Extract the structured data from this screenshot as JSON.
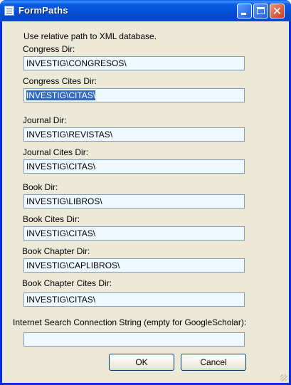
{
  "window": {
    "title": "FormPaths"
  },
  "intro": "Use relative path to XML database.",
  "fields": [
    {
      "label": "Congress Dir:",
      "value": "INVESTIG\\CONGRESOS\\"
    },
    {
      "label": "Congress Cites Dir:",
      "value": "INVESTIG\\CITAS\\"
    },
    {
      "label": "Journal Dir:",
      "value": "INVESTIG\\REVISTAS\\"
    },
    {
      "label": "Journal Cites Dir:",
      "value": "INVESTIG\\CITAS\\"
    },
    {
      "label": "Book Dir:",
      "value": "INVESTIG\\LIBROS\\"
    },
    {
      "label": "Book Cites Dir:",
      "value": "INVESTIG\\CITAS\\"
    },
    {
      "label": "Book Chapter Dir:",
      "value": "INVESTIG\\CAPLIBROS\\"
    },
    {
      "label": "Book Chapter Cites Dir:",
      "value": "INVESTIG\\CITAS\\"
    },
    {
      "label": "Internet Search Connection String (empty for GoogleScholar):",
      "value": ""
    }
  ],
  "buttons": {
    "ok": "OK",
    "cancel": "Cancel"
  },
  "colors": {
    "titlebar": "#0a5ce6",
    "background": "#ece9d8",
    "field_bg": "#f0f8ff",
    "selection": "#316ac5"
  },
  "icons": {
    "app": "form-icon",
    "minimize": "minimize-icon",
    "maximize": "maximize-icon",
    "close": "close-icon",
    "grip": "resize-grip-icon"
  }
}
